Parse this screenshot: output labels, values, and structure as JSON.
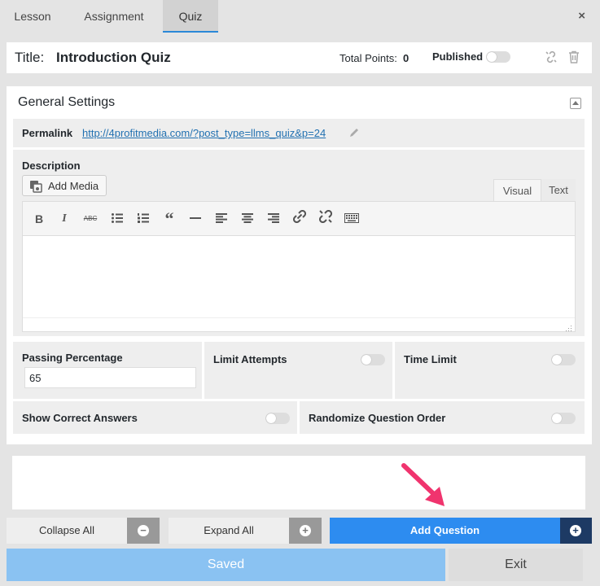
{
  "tabs": [
    {
      "label": "Lesson"
    },
    {
      "label": "Assignment"
    },
    {
      "label": "Quiz"
    }
  ],
  "close_icon": "×",
  "titlebar": {
    "title_label": "Title:",
    "title_value": "Introduction Quiz",
    "total_points_label": "Total Points:",
    "total_points_value": "0",
    "published_label": "Published",
    "published": false
  },
  "settings": {
    "heading": "General Settings",
    "permalink_label": "Permalink",
    "permalink_url": "http://4profitmedia.com/?post_type=llms_quiz&p=24",
    "description_label": "Description",
    "add_media_label": "Add Media",
    "editor_tabs": {
      "visual": "Visual",
      "text": "Text"
    },
    "toolbar_icons": [
      "bold-icon",
      "italic-icon",
      "strikethrough-icon",
      "bulleted-list-icon",
      "numbered-list-icon",
      "blockquote-icon",
      "horizontal-line-icon",
      "align-left-icon",
      "align-center-icon",
      "align-right-icon",
      "insert-link-icon",
      "remove-link-icon",
      "toolbar-toggle-icon"
    ],
    "passing_percentage_label": "Passing Percentage",
    "passing_percentage_value": "65",
    "limit_attempts_label": "Limit Attempts",
    "time_limit_label": "Time Limit",
    "show_correct_answers_label": "Show Correct Answers",
    "randomize_label": "Randomize Question Order"
  },
  "actions": {
    "collapse_all": "Collapse All",
    "expand_all": "Expand All",
    "add_question": "Add Question",
    "saved": "Saved",
    "exit": "Exit"
  },
  "colors": {
    "accent_blue": "#2b88d8",
    "add_question_bg": "#2d8cf0",
    "saved_bg": "#8ac2f2",
    "arrow_pink": "#f0346e"
  }
}
